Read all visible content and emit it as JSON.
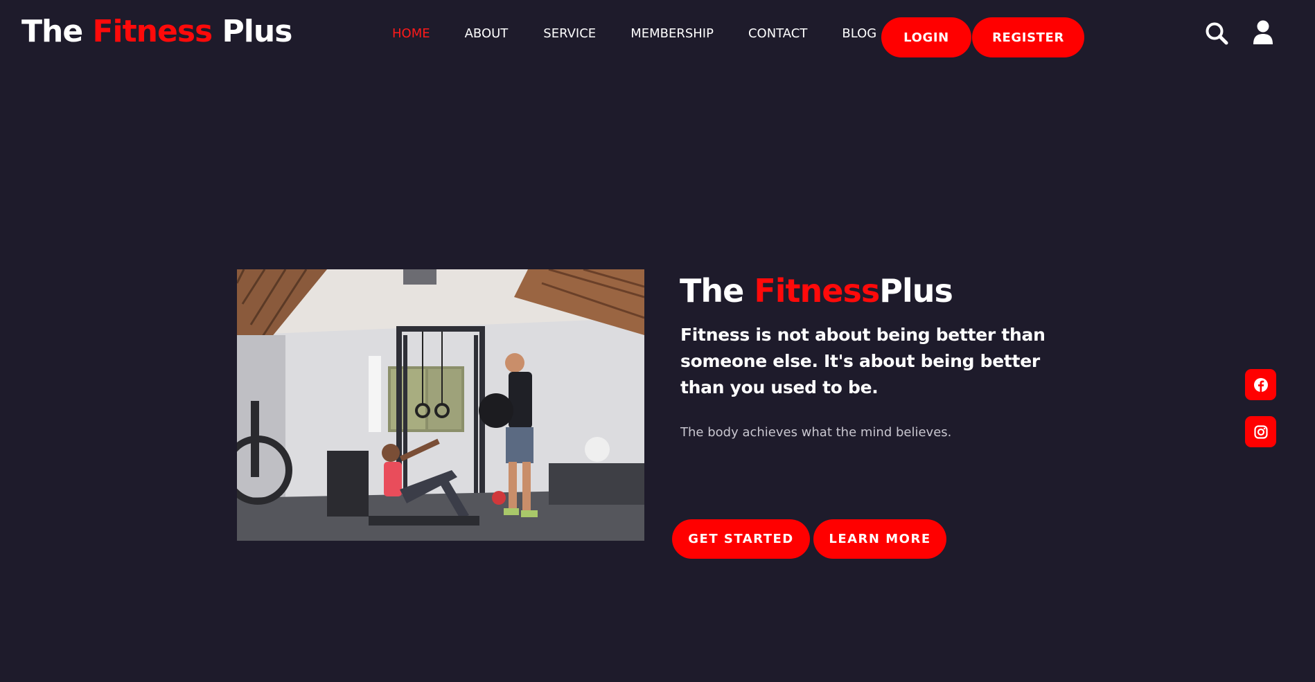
{
  "header": {
    "logo": {
      "part1": "The ",
      "part2": "Fitness",
      "part3": " Plus"
    },
    "nav": [
      {
        "label": "HOME",
        "active": true
      },
      {
        "label": "ABOUT",
        "active": false
      },
      {
        "label": "SERVICE",
        "active": false
      },
      {
        "label": "MEMBERSHIP",
        "active": false
      },
      {
        "label": "CONTACT",
        "active": false
      },
      {
        "label": "BLOG",
        "active": false
      }
    ],
    "login_label": "LOGIN",
    "register_label": "REGISTER",
    "icons": {
      "search": "search-icon",
      "user": "user-icon"
    }
  },
  "hero": {
    "title": {
      "part1": "The ",
      "part2": "Fitness",
      "part3": "Plus"
    },
    "quote": "Fitness is not about being better than someone else. It's about being better than you used to be.",
    "subtitle": "The body achieves what the mind believes.",
    "get_started_label": "GET STARTED",
    "learn_more_label": "LEARN MORE",
    "image": "gym-photo: woman doing sit-ups with medicine ball, man standing beside squat rack in home garage gym"
  },
  "social": {
    "icons": [
      "facebook-icon",
      "instagram-icon"
    ]
  },
  "colors": {
    "background": "#1e1b2b",
    "accent": "#ff0000",
    "text": "#ffffff",
    "muted_text": "#c9c7d0"
  }
}
